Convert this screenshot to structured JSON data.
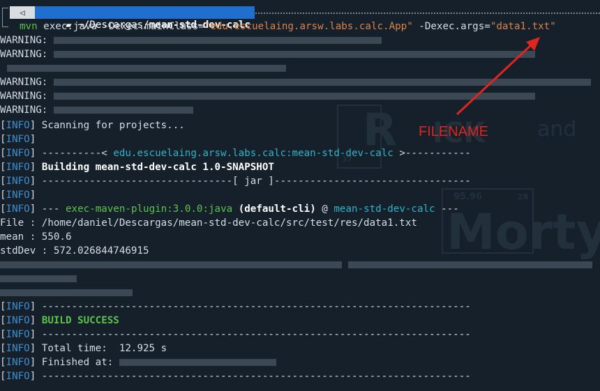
{
  "prompt": {
    "path_prefix": "~/Descargas/",
    "path_dir": "mean-std-dev-calc",
    "icon": "folder-icon",
    "os_icon": "terminal-os-icon"
  },
  "command": {
    "mvn": "mvn",
    "part1": " exec:java -Dexec.mainClass=",
    "main_class": "\"edu.escuelaing.arsw.labs.calc.App\"",
    "part2": " -Dexec.args=",
    "args": "\"data1.txt\""
  },
  "annotation": {
    "label": "FILENAME",
    "color": "#e0241f"
  },
  "warning_label": "WARNING:",
  "info_tag": "INFO",
  "scanning": " Scanning for projects...",
  "module_line": {
    "left": " ----------< ",
    "artifact": "edu.escuelaing.arsw.labs.calc:mean-std-dev-calc",
    "right": " >-----------"
  },
  "building": "Building mean-std-dev-calc 1.0-SNAPSHOT",
  "jar_line": " --------------------------------[ jar ]---------------------------------",
  "plugin_line": {
    "left": " --- ",
    "plugin": "exec-maven-plugin:3.0.0:java",
    "cli": " (default-cli)",
    "at": " @ ",
    "project": "mean-std-dev-calc",
    "right": " ---"
  },
  "output": {
    "file": "File : /home/daniel/Descargas/mean-std-dev-calc/src/test/res/data1.txt",
    "mean": "mean : 550.6",
    "stddev": "stdDev : 572.026844746915"
  },
  "separator": " ------------------------------------------------------------------------",
  "build_success": "BUILD SUCCESS",
  "total_time": " Total time:  12.925 s",
  "finished_at": " Finished at: ",
  "watermark": {
    "word1": "R",
    "word2": "ICK",
    "word3": "and",
    "word4": "Morty",
    "num1": "37",
    "num2": "95.96",
    "num3": "28"
  },
  "colors": {
    "background": "#15202b",
    "info": "#3d8fd1",
    "cyan": "#2fb3c6",
    "green": "#5cc24d",
    "orange": "#d8844d",
    "prompt_bg": "#1f6fd1"
  }
}
